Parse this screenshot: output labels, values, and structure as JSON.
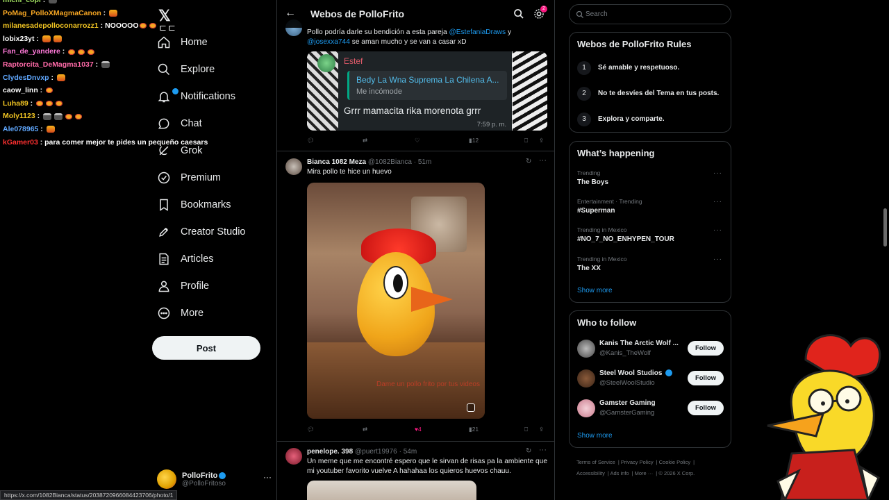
{
  "chat": [
    {
      "user": "michi_copi",
      "user_color": "#a0e060",
      "msg": "",
      "emotes": [
        "hat"
      ]
    },
    {
      "user": "PoMag_PolloXMagmaCanon",
      "user_color": "#f6a623",
      "msg": "",
      "emotes": [
        "fire"
      ]
    },
    {
      "user": "milanesadepolloconarrozz1",
      "user_color": "#f3c623",
      "msg": "NOOOOO",
      "emotes": [
        "egg",
        "egg"
      ]
    },
    {
      "user": "lobix23yt",
      "user_color": "#ffffff",
      "msg": "",
      "emotes": [
        "fire",
        "fire"
      ]
    },
    {
      "user": "Fan_de_yandere",
      "user_color": "#ff7ad9",
      "msg": "",
      "emotes": [
        "egg",
        "egg",
        "egg"
      ]
    },
    {
      "user": "Raptorcita_DeMagma1037",
      "user_color": "#ff6aa8",
      "msg": "",
      "emotes": [
        "hat"
      ]
    },
    {
      "user": "ClydesDnvxp",
      "user_color": "#60a8ff",
      "msg": "",
      "emotes": [
        "fire"
      ]
    },
    {
      "user": "caow_linn",
      "user_color": "#ffffff",
      "msg": "",
      "emotes": [
        "egg"
      ]
    },
    {
      "user": "Luha89",
      "user_color": "#f3c623",
      "msg": "",
      "emotes": [
        "egg",
        "egg",
        "egg"
      ]
    },
    {
      "user": "Moly1123",
      "user_color": "#f3c623",
      "msg": "",
      "emotes": [
        "hat",
        "hat",
        "egg",
        "egg"
      ]
    },
    {
      "user": "Ale078965",
      "user_color": "#60a8ff",
      "msg": "",
      "emotes": [
        "fire"
      ]
    },
    {
      "user": "kGamer03",
      "user_color": "#ff3030",
      "msg": "para comer mejor te pides un pequeño caesars",
      "emotes": []
    }
  ],
  "nav": {
    "items": [
      {
        "label": "Home",
        "icon": "home-icon"
      },
      {
        "label": "Explore",
        "icon": "search-icon"
      },
      {
        "label": "Notifications",
        "icon": "bell-icon"
      },
      {
        "label": "Chat",
        "icon": "chat-icon"
      },
      {
        "label": "Grok",
        "icon": "grok-icon"
      },
      {
        "label": "Premium",
        "icon": "premium-icon"
      },
      {
        "label": "Bookmarks",
        "icon": "bookmark-icon"
      },
      {
        "label": "Creator Studio",
        "icon": "rocket-icon"
      },
      {
        "label": "Articles",
        "icon": "article-icon"
      },
      {
        "label": "Profile",
        "icon": "person-icon"
      },
      {
        "label": "More",
        "icon": "more-circle-icon"
      }
    ],
    "post_label": "Post",
    "account": {
      "name": "PolloFrito",
      "handle": "@PolloFritoso"
    }
  },
  "header": {
    "title": "Webos de PolloFrito",
    "settings_badge": "2"
  },
  "tweets": {
    "t1": {
      "text_before": "Pollo podría darle su bendición a esta pareja ",
      "mention1": "@EstefaniaDraws",
      "text_mid": " y",
      "mention2": "@josexxa744",
      "text_after": " se aman mucho y se van a casar xD",
      "quote": {
        "sender": "Estef",
        "reply_name": "Bedy La Wna Suprema La Chilena A...",
        "reply_text": "Me incómode",
        "message": "Grrr mamacita rika morenota grrr",
        "time": "7:59 p. m."
      },
      "views": "12"
    },
    "t2": {
      "name": "Bianca 1082 Meza",
      "handle": "@1082Bianca",
      "time": "· 51m",
      "text": "Mira pollo te hice un huevo",
      "watermark": "Dame un pollo frito por tus videos",
      "likes": "4",
      "views": "21"
    },
    "t3": {
      "name": "penelope. 398",
      "handle": "@puert19976",
      "time": "· 54m",
      "text": "Un meme que me encontré espero que le sirvan de risas pa la ambiente que mi youtuber favorito vuelve A hahahaa los quieros huevos chauu."
    }
  },
  "search": {
    "placeholder": "Search"
  },
  "rules": {
    "title": "Webos de PolloFrito Rules",
    "items": [
      {
        "num": "1",
        "text": "Sé amable y respetuoso."
      },
      {
        "num": "2",
        "text": "No te desvíes del Tema en tus posts."
      },
      {
        "num": "3",
        "text": "Explora y comparte."
      }
    ]
  },
  "happening": {
    "title": "What’s happening",
    "items": [
      {
        "ctx": "Trending",
        "name": "The Boys"
      },
      {
        "ctx": "Entertainment · Trending",
        "name": "#Superman"
      },
      {
        "ctx": "Trending in Mexico",
        "name": "#NO_7_NO_ENHYPEN_TOUR"
      },
      {
        "ctx": "Trending in Mexico",
        "name": "The XX"
      }
    ],
    "show_more": "Show more"
  },
  "who_to_follow": {
    "title": "Who to follow",
    "items": [
      {
        "name": "Kanis The Arctic Wolf ...",
        "handle": "@Kanis_TheWolf",
        "follow": "Follow"
      },
      {
        "name": "Steel Wool Studios",
        "handle": "@SteelWoolStudio",
        "follow": "Follow"
      },
      {
        "name": "Gamster Gaming",
        "handle": "@GamsterGaming",
        "follow": "Follow"
      }
    ],
    "show_more": "Show more"
  },
  "footer": {
    "links": [
      "Terms of Service",
      "Privacy Policy",
      "Cookie Policy",
      "Accessibility",
      "Ads info",
      "More ···",
      "© 2026 X Corp."
    ]
  },
  "statusbar": {
    "url": "https://x.com/1082Bianca/status/2038720966084423706/photo/1"
  },
  "colors": {
    "accent": "#1d9bf0",
    "like": "#f91880",
    "bg": "#000000",
    "border": "#2f3336"
  }
}
